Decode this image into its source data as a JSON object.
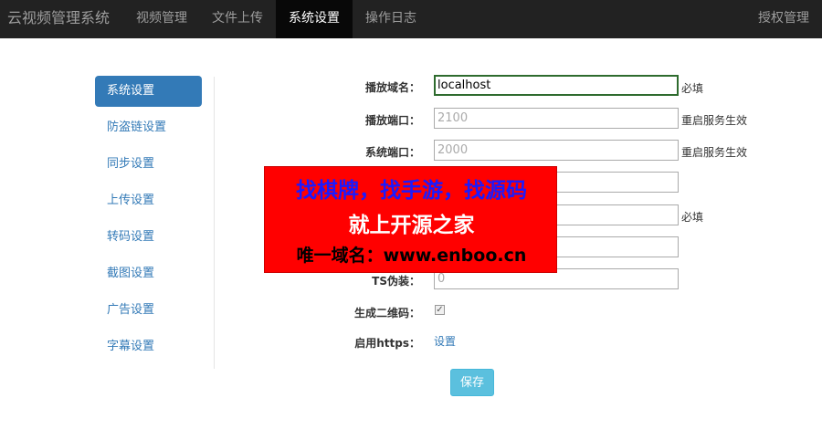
{
  "navbar": {
    "brand": "云视频管理系统",
    "items": [
      {
        "label": "视频管理"
      },
      {
        "label": "文件上传"
      },
      {
        "label": "系统设置",
        "active": true
      },
      {
        "label": "操作日志"
      }
    ],
    "right": "授权管理"
  },
  "sidebar": {
    "items": [
      {
        "label": "系统设置",
        "active": true
      },
      {
        "label": "防盗链设置"
      },
      {
        "label": "同步设置"
      },
      {
        "label": "上传设置"
      },
      {
        "label": "转码设置"
      },
      {
        "label": "截图设置"
      },
      {
        "label": "广告设置"
      },
      {
        "label": "字幕设置"
      }
    ]
  },
  "form": {
    "play_domain": {
      "label": "播放域名：",
      "value": "localhost",
      "hint": "必填"
    },
    "play_port": {
      "label": "播放端口：",
      "placeholder": "2100",
      "hint": "重启服务生效"
    },
    "system_port": {
      "label": "系统端口：",
      "placeholder": "2000",
      "hint": "重启服务生效"
    },
    "row4": {
      "value": ""
    },
    "row5": {
      "value": "",
      "hint": "必填"
    },
    "row6": {
      "value": ""
    },
    "ts_disguise": {
      "label": "TS伪装：",
      "placeholder": "0"
    },
    "qrcode": {
      "label": "生成二维码：",
      "checked": true
    },
    "https": {
      "label": "启用https：",
      "link": "设置"
    },
    "save": "保存"
  },
  "banner": {
    "line1": "找棋牌，找手游，找源码",
    "line2": "就上开源之家",
    "line3": "唯一域名：www.enboo.cn"
  },
  "colors": {
    "navbar_bg": "#222222",
    "accent": "#337ab7",
    "save_button": "#5bc0de",
    "banner_bg": "#ff0000"
  }
}
